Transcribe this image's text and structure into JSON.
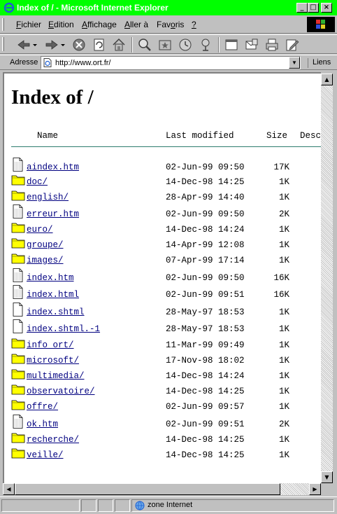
{
  "window": {
    "title": "Index of / - Microsoft Internet Explorer",
    "minimize": "_",
    "maximize": "□",
    "close": "×"
  },
  "menu": [
    {
      "label": "Fichier",
      "u": "F",
      "rest": "ichier"
    },
    {
      "label": "Edition",
      "u": "E",
      "rest": "dition"
    },
    {
      "label": "Affichage",
      "u": "A",
      "rest": "ffichage"
    },
    {
      "label": "Aller à",
      "u": "A",
      "rest": "ller à"
    },
    {
      "label": "Favoris",
      "u": "o",
      "pre": "Fav",
      "rest": "ris"
    },
    {
      "label": "?",
      "u": "?",
      "rest": ""
    }
  ],
  "address": {
    "label": "Adresse",
    "url": "http://www.ort.fr/",
    "links_label": "Liens"
  },
  "page": {
    "heading": "Index of /",
    "columns": {
      "name": "Name",
      "modified": "Last modified",
      "size": "Size",
      "desc": "Desc"
    },
    "rows": [
      {
        "name": "aindex.htm",
        "date": "02-Jun-99 09:50",
        "size": "17K",
        "icon": "html-file-icon"
      },
      {
        "name": "doc/",
        "date": "14-Dec-98 14:25",
        "size": "1K",
        "icon": "folder-icon"
      },
      {
        "name": "english/",
        "date": "28-Apr-99 14:40",
        "size": "1K",
        "icon": "folder-icon"
      },
      {
        "name": "erreur.htm",
        "date": "02-Jun-99 09:50",
        "size": "2K",
        "icon": "html-file-icon"
      },
      {
        "name": "euro/",
        "date": "14-Dec-98 14:24",
        "size": "1K",
        "icon": "folder-icon"
      },
      {
        "name": "groupe/",
        "date": "14-Apr-99 12:08",
        "size": "1K",
        "icon": "folder-icon"
      },
      {
        "name": "images/",
        "date": "07-Apr-99 17:14",
        "size": "1K",
        "icon": "folder-icon"
      },
      {
        "name": "index.htm",
        "date": "02-Jun-99 09:50",
        "size": "16K",
        "icon": "html-file-icon"
      },
      {
        "name": "index.html",
        "date": "02-Jun-99 09:51",
        "size": "16K",
        "icon": "html-file-icon"
      },
      {
        "name": "index.shtml",
        "date": "28-May-97 18:53",
        "size": "1K",
        "icon": "blank-file-icon"
      },
      {
        "name": "index.shtml.-1",
        "date": "28-May-97 18:53",
        "size": "1K",
        "icon": "blank-file-icon"
      },
      {
        "name": "info ort/",
        "date": "11-Mar-99 09:49",
        "size": "1K",
        "icon": "folder-icon"
      },
      {
        "name": "microsoft/",
        "date": "17-Nov-98 18:02",
        "size": "1K",
        "icon": "folder-icon"
      },
      {
        "name": "multimedia/",
        "date": "14-Dec-98 14:24",
        "size": "1K",
        "icon": "folder-icon"
      },
      {
        "name": "observatoire/",
        "date": "14-Dec-98 14:25",
        "size": "1K",
        "icon": "folder-icon"
      },
      {
        "name": "offre/",
        "date": "02-Jun-99 09:57",
        "size": "1K",
        "icon": "folder-icon"
      },
      {
        "name": "ok.htm",
        "date": "02-Jun-99 09:51",
        "size": "2K",
        "icon": "html-file-icon"
      },
      {
        "name": "recherche/",
        "date": "14-Dec-98 14:25",
        "size": "1K",
        "icon": "folder-icon"
      },
      {
        "name": "veille/",
        "date": "14-Dec-98 14:25",
        "size": "1K",
        "icon": "folder-icon"
      }
    ]
  },
  "status": {
    "zone": "zone Internet"
  },
  "colors": {
    "titlebar": "#00ff00",
    "link": "#000080",
    "folder": "#ffff00",
    "rule": "#2e7d6f"
  }
}
